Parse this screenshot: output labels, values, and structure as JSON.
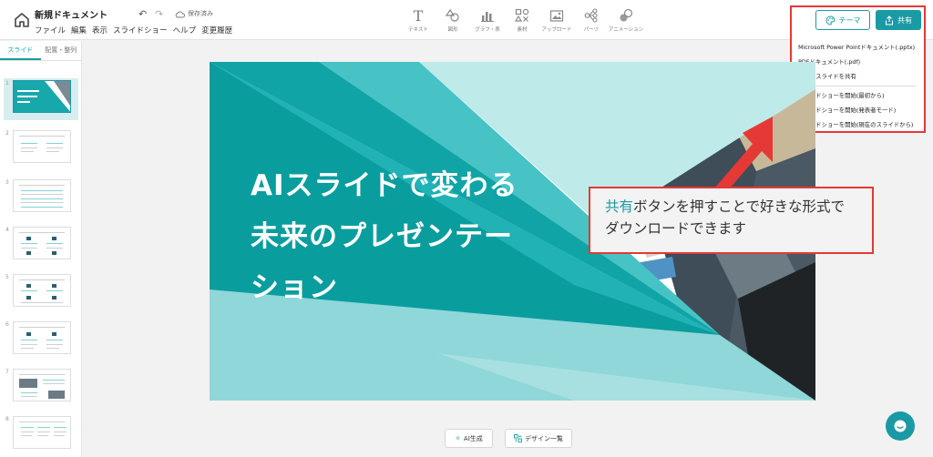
{
  "header": {
    "doc_title": "新規ドキュメント",
    "saved_label": "保存済み",
    "menu": [
      "ファイル",
      "編集",
      "表示",
      "スライドショー",
      "ヘルプ",
      "変更履歴"
    ]
  },
  "tools": [
    {
      "label": "テキスト",
      "icon": "text-icon"
    },
    {
      "label": "図形",
      "icon": "shapes-icon"
    },
    {
      "label": "グラフ・表",
      "icon": "chart-icon"
    },
    {
      "label": "素材",
      "icon": "assets-icon"
    },
    {
      "label": "アップロード",
      "icon": "upload-icon"
    },
    {
      "label": "パーツ",
      "icon": "parts-icon"
    },
    {
      "label": "アニメーション",
      "icon": "animation-icon"
    }
  ],
  "buttons": {
    "theme": "テーマ",
    "share": "共有",
    "ai": "AI生成",
    "design": "デザイン一覧"
  },
  "share_menu": {
    "group1": [
      "Microsoft Power Pointドキュメント(.pptx)",
      "PDFドキュメント(.pdf)",
      "URLでスライドを共有"
    ],
    "group2": [
      "スライドショーを開始(最初から)",
      "スライドショーを開始(発表者モード)",
      "スライドショーを開始(現在のスライドから)"
    ]
  },
  "sidebar": {
    "tabs": [
      "スライド",
      "配置・整列"
    ],
    "slide_numbers": [
      "1",
      "2",
      "3",
      "4",
      "5",
      "6",
      "7",
      "8"
    ]
  },
  "slide": {
    "title": "AIスライドで変わる未来のプレゼンテーション"
  },
  "callout": {
    "highlight": "共有",
    "text_rest": "ボタンを押すことで好きな形式でダウンロードできます"
  },
  "colors": {
    "accent": "#1a9aa5",
    "annotation": "#e53935"
  }
}
